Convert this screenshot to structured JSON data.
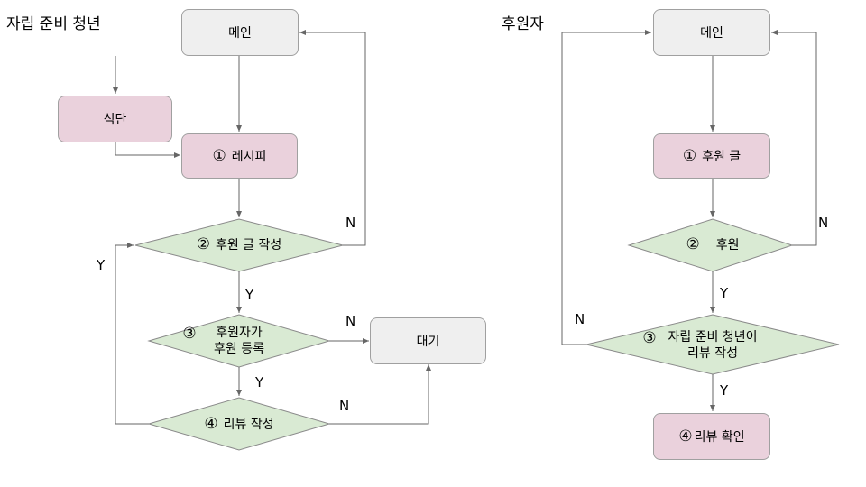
{
  "left_flow": {
    "title": "자립 준비 청년",
    "main": "메인",
    "menu": "식단",
    "recipe": {
      "num": "①",
      "label": "레시피"
    },
    "write_post": {
      "num": "②",
      "label": "후원 글 작성"
    },
    "sponsor_register": {
      "num": "③",
      "line1": "후원자가",
      "line2": "후원 등록"
    },
    "review": {
      "num": "④",
      "label": "리뷰 작성"
    },
    "wait": "대기",
    "edge_labels": {
      "write_post_no": "N",
      "write_post_yes": "Y",
      "register_no": "N",
      "register_yes": "Y",
      "review_no": "N",
      "review_yes": "Y"
    }
  },
  "right_flow": {
    "title": "후원자",
    "main": "메인",
    "sponsor_post": {
      "num": "①",
      "label": "후원 글"
    },
    "sponsor": {
      "num": "②",
      "label": "후원"
    },
    "youth_review": {
      "num": "③",
      "line1": "자립 준비 청년이",
      "line2": "리뷰 작성"
    },
    "check_review": {
      "num": "④",
      "label": "리뷰 확인"
    },
    "edge_labels": {
      "sponsor_no": "N",
      "sponsor_yes": "Y",
      "youth_review_no": "N",
      "youth_review_yes": "Y"
    }
  },
  "colors": {
    "process_gray": "#efefef",
    "process_pink": "#ead1dc",
    "decision_green": "#d9ead3",
    "line": "#666666",
    "border": "#a0a0a0"
  }
}
